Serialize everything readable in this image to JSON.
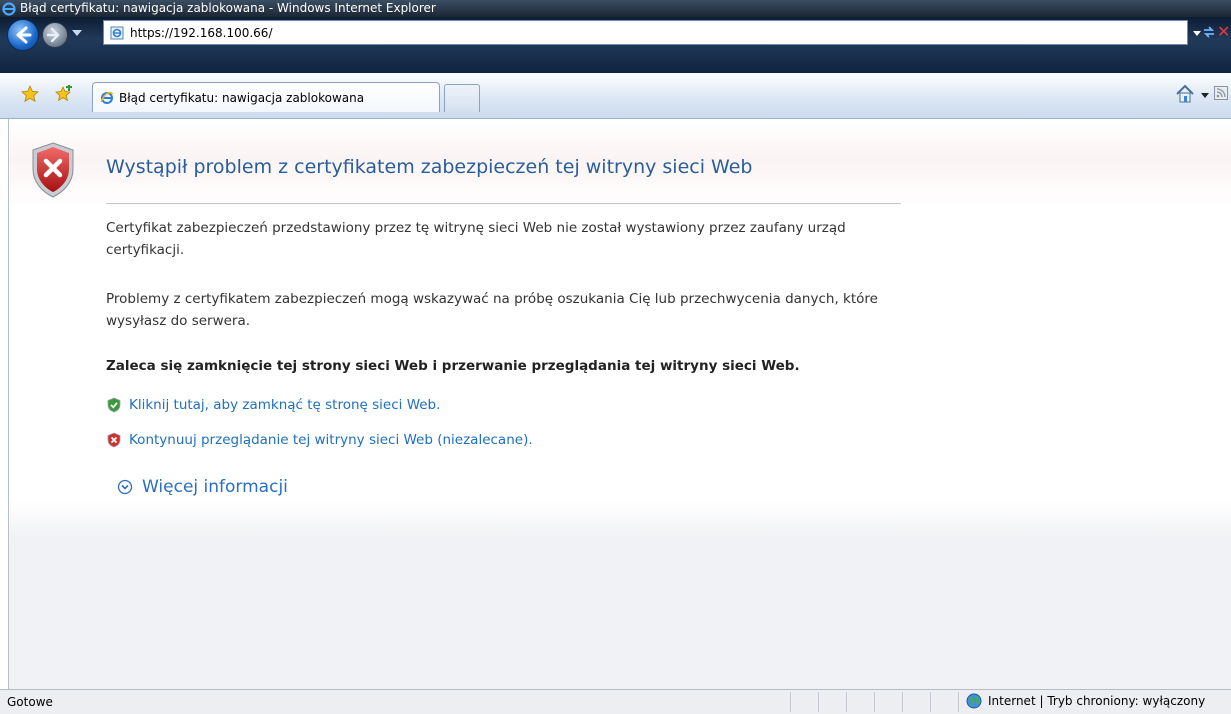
{
  "window": {
    "title": "Błąd certyfikatu: nawigacja zablokowana - Windows Internet Explorer"
  },
  "address_bar": {
    "url": "https://192.168.100.66/"
  },
  "tabs": [
    {
      "label": "Błąd certyfikatu: nawigacja zablokowana",
      "active": true
    },
    {
      "label": "",
      "active": false
    }
  ],
  "page": {
    "title": "Wystąpił problem z certyfikatem zabezpieczeń tej witryny sieci Web",
    "paragraph1": "Certyfikat zabezpieczeń przedstawiony przez tę witrynę sieci Web nie został wystawiony przez zaufany urząd certyfikacji.",
    "paragraph2": "Problemy z certyfikatem zabezpieczeń mogą wskazywać na próbę oszukania Cię lub przechwycenia danych, które wysyłasz do serwera.",
    "recommendation": "Zaleca się zamknięcie tej strony sieci Web i przerwanie przeglądania tej witryny sieci Web.",
    "close_link": "Kliknij tutaj, aby zamknąć tę stronę sieci Web.",
    "continue_link": "Kontynuuj przeglądanie tej witryny sieci Web (niezalecane).",
    "more_info": "Więcej informacji"
  },
  "status_bar": {
    "text": "Gotowe",
    "zone": "Internet | Tryb chroniony: wyłączony"
  },
  "colors": {
    "link": "#1f6fc1",
    "title": "#2a5d9b",
    "error_red": "#d32f2f",
    "ok_green": "#3a9a3a"
  },
  "icons": [
    "ie-logo-icon",
    "back-icon",
    "forward-icon",
    "page-icon",
    "refresh-icon",
    "stop-icon",
    "favorites-star-icon",
    "add-favorite-icon",
    "home-icon",
    "feeds-icon",
    "error-shield-icon",
    "green-shield-icon",
    "red-shield-icon",
    "expand-icon",
    "globe-icon"
  ]
}
